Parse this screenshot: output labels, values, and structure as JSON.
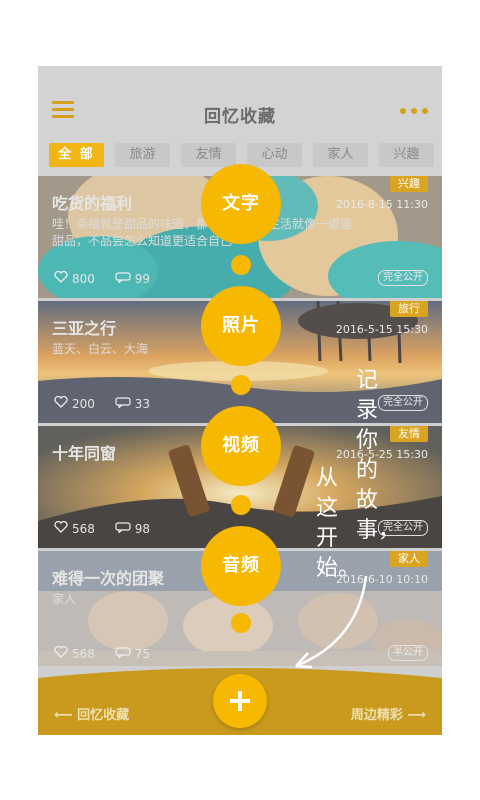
{
  "header": {
    "title": "回忆收藏"
  },
  "tabs": [
    "全 部",
    "旅游",
    "友情",
    "心动",
    "家人",
    "兴趣"
  ],
  "cards": [
    {
      "title": "吃货的福利",
      "desc": "哇！幸福就是甜品的味道，都有一个胃：生活就像一道道甜品，不品尝怎么知道更适合自己",
      "tag": "兴趣",
      "datetime": "2016-8-15 11:30",
      "likes": "800",
      "comments": "99",
      "visibility": "完全公开"
    },
    {
      "title": "三亚之行",
      "desc": "蓝天、白云、大海",
      "tag": "旅行",
      "datetime": "2016-5-15 15:30",
      "likes": "200",
      "comments": "33",
      "visibility": "完全公开"
    },
    {
      "title": "十年同窗",
      "desc": "",
      "tag": "友情",
      "datetime": "2016-5-25 15:30",
      "likes": "568",
      "comments": "98",
      "visibility": "完全公开"
    },
    {
      "title": "难得一次的团聚",
      "desc": "家人",
      "tag": "家人",
      "datetime": "2016-6-10 10:10",
      "likes": "568",
      "comments": "75",
      "visibility": "半公开"
    }
  ],
  "fab_menu": [
    "文字",
    "照片",
    "视频",
    "音频"
  ],
  "slogan": {
    "col1": "记录你的故事，",
    "col2": "从这开始。"
  },
  "footer": {
    "left": "回忆收藏",
    "right": "周边精彩"
  },
  "colors": {
    "accent": "#f6b800",
    "tag": "#d9a421",
    "footer": "#c99a1d"
  }
}
